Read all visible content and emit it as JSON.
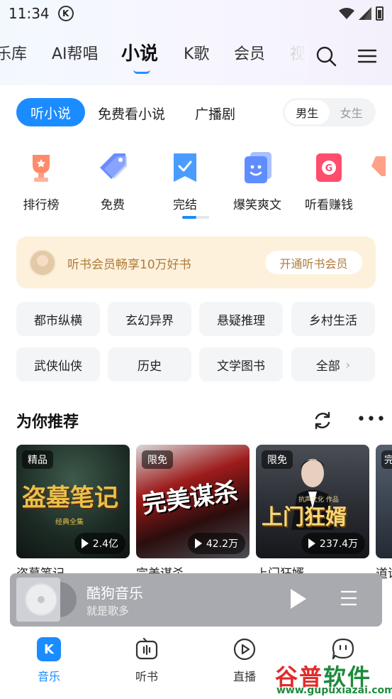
{
  "status_bar": {
    "time": "11:34",
    "k_badge": "K"
  },
  "top_tabs": {
    "items": [
      "乐库",
      "AI帮唱",
      "小说",
      "K歌",
      "会员",
      "视"
    ],
    "active": "小说"
  },
  "sub_tabs": {
    "active_label": "听小说",
    "items": [
      "免费看小说",
      "广播剧"
    ],
    "gender": {
      "male": "男生",
      "female": "女生",
      "selected": "男生"
    }
  },
  "categories": [
    {
      "label": "排行榜",
      "icon": "trophy-icon",
      "color": "#ff8a6a"
    },
    {
      "label": "免费",
      "icon": "tag-icon",
      "color": "#6a8cff"
    },
    {
      "label": "完结",
      "icon": "bookmark-check-icon",
      "color": "#4a9cff"
    },
    {
      "label": "爆笑爽文",
      "icon": "smile-card-icon",
      "color": "#5f8dff"
    },
    {
      "label": "听看赚钱",
      "icon": "coin-card-icon",
      "color": "#ff4d6d"
    }
  ],
  "vip_banner": {
    "text": "听书会员畅享10万好书",
    "button": "开通听书会员"
  },
  "genres": [
    "都市纵横",
    "玄幻异界",
    "悬疑推理",
    "乡村生活",
    "武侠仙侠",
    "历史",
    "文学图书",
    "全部"
  ],
  "recommend": {
    "title": "为你推荐",
    "books": [
      {
        "tag": "精品",
        "plays": "2.4亿",
        "name": "盗墓笔记",
        "cover_text": "盗墓笔记",
        "cover_sub": "经典全集"
      },
      {
        "tag": "限免",
        "plays": "42.2万",
        "name": "完美谋杀",
        "cover_text": "完美谋杀",
        "cover_sub": ""
      },
      {
        "tag": "限免",
        "plays": "237.4万",
        "name": "上门狂婿",
        "cover_text": "上门狂婿",
        "cover_sub": "抗声文化 作品"
      },
      {
        "tag": "完",
        "plays": "",
        "name": "道诡",
        "cover_text": "",
        "cover_sub": ""
      }
    ]
  },
  "mini_player": {
    "title": "酷狗音乐",
    "subtitle": "就是歌多"
  },
  "bottom_nav": [
    {
      "label": "音乐",
      "icon": "music-k-icon",
      "active": true
    },
    {
      "label": "听书",
      "icon": "radio-book-icon",
      "active": false
    },
    {
      "label": "直播",
      "icon": "live-play-icon",
      "active": false
    },
    {
      "label": "",
      "icon": "chat-bubble-icon",
      "active": false
    }
  ],
  "watermark": {
    "main_a": "谷普",
    "main_b": "软件园",
    "url": "www.gupuxiazai.com"
  },
  "colors": {
    "accent": "#1a8cff",
    "vip_text": "#b07a3a",
    "vip_bg": "#fdf1dc"
  }
}
